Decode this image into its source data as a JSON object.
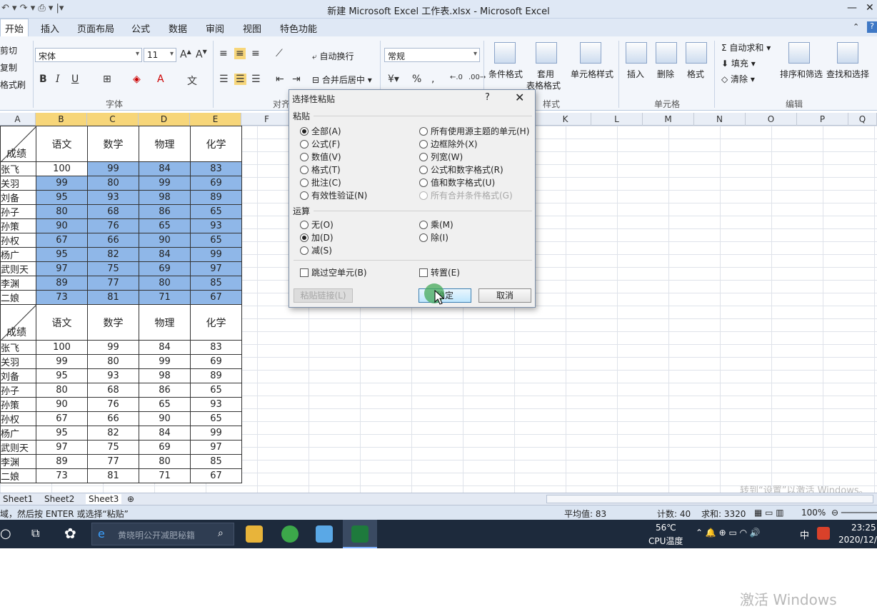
{
  "window": {
    "title": "新建 Microsoft Excel 工作表.xlsx - Microsoft Excel"
  },
  "tabs": [
    "开始",
    "插入",
    "页面布局",
    "公式",
    "数据",
    "审阅",
    "视图",
    "特色功能"
  ],
  "ribbon": {
    "clipboard": {
      "cut": "剪切",
      "copy": "复制",
      "format_painter": "格式刷"
    },
    "font": {
      "name": "宋体",
      "size": "11",
      "group": "字体"
    },
    "alignment": {
      "wrap": "自动换行",
      "merge": "合并后居中",
      "group": "对齐"
    },
    "number": {
      "format": "常规",
      "percent": "%"
    },
    "styles": {
      "conditional": "条件格式",
      "table_line1": "套用",
      "table_line2": "表格格式",
      "cell_styles": "单元格样式",
      "group": "样式"
    },
    "cells": {
      "insert": "插入",
      "delete": "删除",
      "format": "格式",
      "group": "单元格"
    },
    "editing": {
      "autosum": "自动求和",
      "fill": "填充",
      "clear": "清除",
      "sort": "排序和筛选",
      "find": "查找和选择",
      "group": "编辑"
    }
  },
  "columns": [
    "A",
    "B",
    "C",
    "D",
    "E",
    "F",
    "",
    "",
    "",
    "",
    "K",
    "L",
    "M",
    "N",
    "O",
    "P",
    "Q"
  ],
  "table_header": {
    "corner": "成绩",
    "subjects": [
      "语文",
      "数学",
      "物理",
      "化学"
    ]
  },
  "rows": [
    {
      "name": "张飞",
      "v": [
        "100",
        "99",
        "84",
        "83"
      ]
    },
    {
      "name": "关羽",
      "v": [
        "99",
        "80",
        "99",
        "69"
      ]
    },
    {
      "name": "刘备",
      "v": [
        "95",
        "93",
        "98",
        "89"
      ]
    },
    {
      "name": "孙子",
      "v": [
        "80",
        "68",
        "86",
        "65"
      ]
    },
    {
      "name": "孙策",
      "v": [
        "90",
        "76",
        "65",
        "93"
      ]
    },
    {
      "name": "孙权",
      "v": [
        "67",
        "66",
        "90",
        "65"
      ]
    },
    {
      "name": "杨广",
      "v": [
        "95",
        "82",
        "84",
        "99"
      ]
    },
    {
      "name": "武则天",
      "v": [
        "97",
        "75",
        "69",
        "97"
      ]
    },
    {
      "name": "李渊",
      "v": [
        "89",
        "77",
        "80",
        "85"
      ]
    },
    {
      "name": "二娘",
      "v": [
        "73",
        "81",
        "71",
        "67"
      ]
    }
  ],
  "sheets": [
    "Sheet1",
    "Sheet2",
    "Sheet3"
  ],
  "status": {
    "hint": "域，然后按 ENTER 或选择“粘贴”",
    "average": "平均值: 83",
    "count": "计数: 40",
    "sum": "求和: 3320",
    "zoom": "100%"
  },
  "dialog": {
    "title": "选择性粘贴",
    "help": "?",
    "close": "✕",
    "paste_label": "粘贴",
    "paste_left": [
      "全部(A)",
      "公式(F)",
      "数值(V)",
      "格式(T)",
      "批注(C)",
      "有效性验证(N)"
    ],
    "paste_right": [
      "所有使用源主题的单元(H)",
      "边框除外(X)",
      "列宽(W)",
      "公式和数字格式(R)",
      "值和数字格式(U)",
      "所有合并条件格式(G)"
    ],
    "op_label": "运算",
    "op_left": [
      "无(O)",
      "加(D)",
      "减(S)"
    ],
    "op_right": [
      "乘(M)",
      "除(I)"
    ],
    "skip_blanks": "跳过空单元(B)",
    "transpose": "转置(E)",
    "paste_link": "粘贴链接(L)",
    "ok": "确定",
    "cancel": "取消"
  },
  "taskbar": {
    "search_placeholder": "黄晓明公开减肥秘籍",
    "temp": "56℃",
    "temp_label": "CPU温度",
    "ime": "中",
    "time": "23:25",
    "date": "2020/12/"
  },
  "watermark": {
    "line1": "激活 Windows",
    "line2": "转到“设置”以激活 Windows。"
  }
}
